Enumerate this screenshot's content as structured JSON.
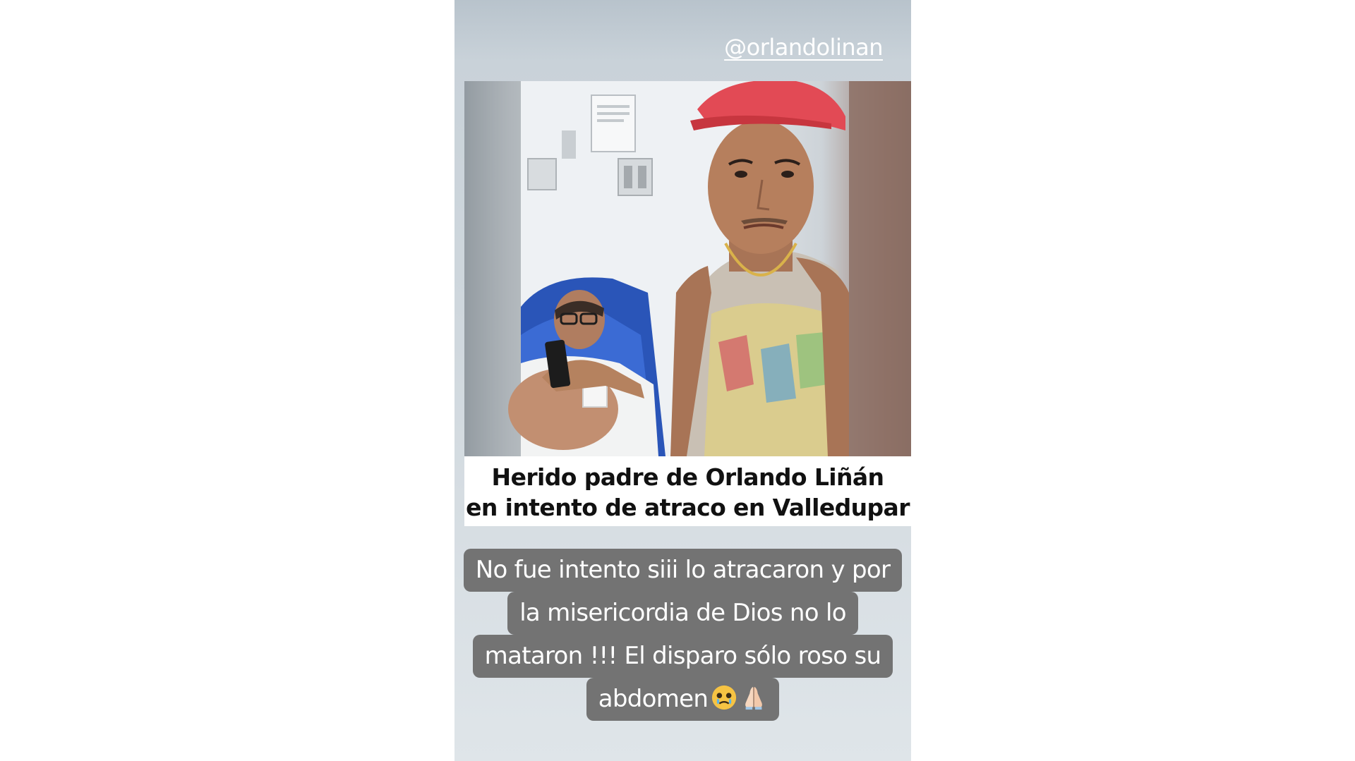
{
  "story": {
    "mention": "@orlandolinan",
    "headline": {
      "line1": "Herido padre de Orlando Liñán",
      "line2": "en intento de atraco en Valledupar"
    },
    "caption": {
      "line1": "No fue intento siii lo atracaron y por",
      "line2": "la misericordia de Dios no lo",
      "line3": "mataron !!! El disparo sólo roso su",
      "line4": "abdomen"
    },
    "caption_emojis": [
      "crying-face-emoji",
      "praying-hands-emoji"
    ]
  }
}
